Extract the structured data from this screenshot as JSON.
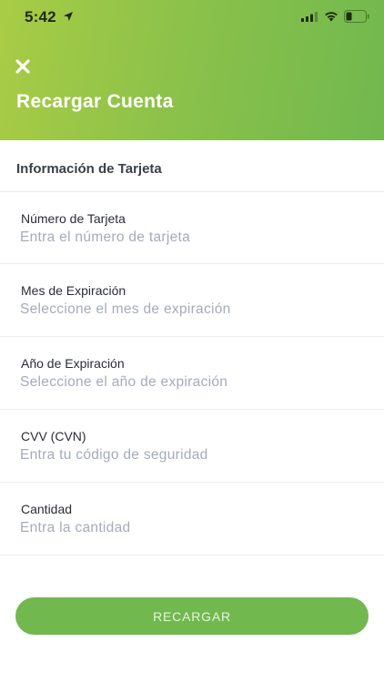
{
  "status_bar": {
    "time": "5:42",
    "icons": [
      "location-arrow-icon",
      "signal-icon",
      "wifi-icon",
      "battery-icon"
    ]
  },
  "header": {
    "close_icon": "close-icon",
    "title": "Recargar Cuenta",
    "gradient_colors": [
      "#a9cc45",
      "#71b84f"
    ]
  },
  "form": {
    "section_title": "Información de Tarjeta",
    "fields": [
      {
        "label": "Número de Tarjeta",
        "placeholder": "Entra el número de tarjeta"
      },
      {
        "label": "Mes de Expiración",
        "placeholder": "Seleccione el mes de expiración"
      },
      {
        "label": "Año de Expiración",
        "placeholder": "Seleccione el año de expiración"
      },
      {
        "label": "CVV (CVN)",
        "placeholder": "Entra tu código de seguridad"
      },
      {
        "label": "Cantidad",
        "placeholder": "Entra la cantidad"
      }
    ]
  },
  "submit": {
    "label": "RECARGAR",
    "color": "#71b84f"
  }
}
